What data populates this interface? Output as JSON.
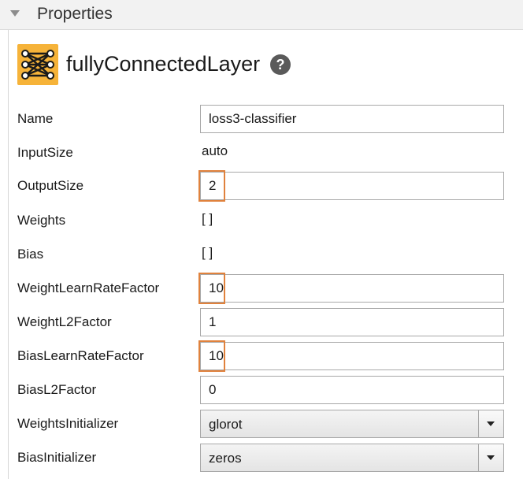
{
  "header": {
    "title": "Properties"
  },
  "layer": {
    "name": "fullyConnectedLayer",
    "help_glyph": "?"
  },
  "properties": [
    {
      "label": "Name",
      "kind": "input",
      "value": "loss3-classifier"
    },
    {
      "label": "InputSize",
      "kind": "text",
      "value": "auto"
    },
    {
      "label": "OutputSize",
      "kind": "input",
      "value": "2",
      "highlighted": true
    },
    {
      "label": "Weights",
      "kind": "text",
      "value": "[ ]"
    },
    {
      "label": "Bias",
      "kind": "text",
      "value": "[ ]"
    },
    {
      "label": "WeightLearnRateFactor",
      "kind": "input",
      "value": "10",
      "highlighted": true
    },
    {
      "label": "WeightL2Factor",
      "kind": "input",
      "value": "1"
    },
    {
      "label": "BiasLearnRateFactor",
      "kind": "input",
      "value": "10",
      "highlighted": true
    },
    {
      "label": "BiasL2Factor",
      "kind": "input",
      "value": "0"
    },
    {
      "label": "WeightsInitializer",
      "kind": "select",
      "value": "glorot"
    },
    {
      "label": "BiasInitializer",
      "kind": "select",
      "value": "zeros"
    }
  ],
  "colors": {
    "icon_bg": "#f6b339",
    "highlight": "#e0823d",
    "header_bg": "#f2f2f2"
  }
}
